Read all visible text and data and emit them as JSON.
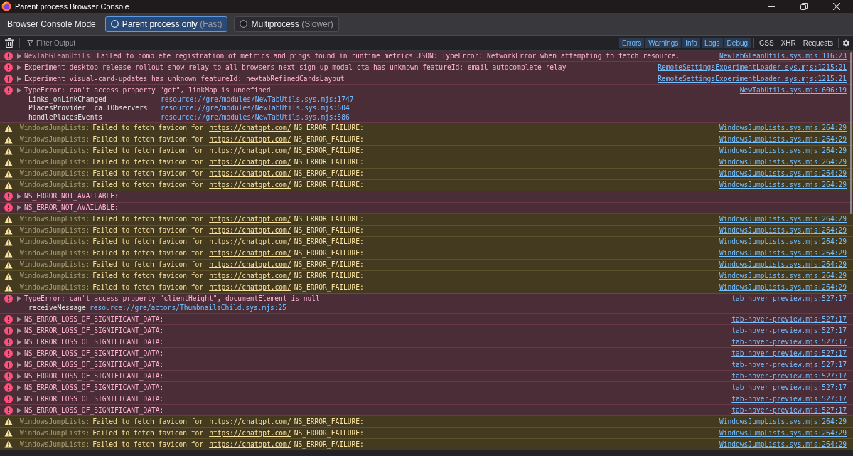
{
  "window": {
    "title": "Parent process Browser Console"
  },
  "mode_bar": {
    "label": "Browser Console Mode",
    "options": [
      {
        "label": "Parent process only",
        "hint": "(Fast)",
        "selected": true
      },
      {
        "label": "Multiprocess",
        "hint": "(Slower)",
        "selected": false
      }
    ]
  },
  "toolbar": {
    "filter_placeholder": "Filter Output",
    "levels": [
      {
        "label": "Errors",
        "selected": true
      },
      {
        "label": "Warnings",
        "selected": true
      },
      {
        "label": "Info",
        "selected": true
      },
      {
        "label": "Logs",
        "selected": true
      },
      {
        "label": "Debug",
        "selected": true
      }
    ],
    "extra_filters": [
      {
        "label": "CSS",
        "selected": false
      },
      {
        "label": "XHR",
        "selected": false
      },
      {
        "label": "Requests",
        "selected": false
      }
    ]
  },
  "messages": [
    {
      "kind": "error",
      "prefix": "NewTabGleanUtils:",
      "text": "Failed to complete registration of metrics and pings found in runtime metrics JSON: TypeError: NetworkError when attempting to fetch resource.",
      "source": "NewTabGleanUtils.sys.mjs:116:23"
    },
    {
      "kind": "error",
      "text": "Experiment desktop-release-rollout-show-relay-to-all-browsers-next-sign-up-modal-cta has unknown featureId: email-autocomplete-relay",
      "source": "RemoteSettingsExperimentLoader.sys.mjs:1215:21"
    },
    {
      "kind": "error",
      "text": "Experiment visual-card-updates has unknown featureId: newtabRefinedCardsLayout",
      "source": "RemoteSettingsExperimentLoader.sys.mjs:1215:21"
    },
    {
      "kind": "error",
      "text": "TypeError: can't access property \"get\", linkMap is undefined",
      "source": "NewTabUtils.sys.mjs:606:19",
      "stack": [
        {
          "function": "Links_onLinkChanged",
          "location": "resource://gre/modules/NewTabUtils.sys.mjs:1747"
        },
        {
          "function": "PlacesProvider__callObservers",
          "location": "resource://gre/modules/NewTabUtils.sys.mjs:604"
        },
        {
          "function": "handlePlacesEvents",
          "location": "resource://gre/modules/NewTabUtils.sys.mjs:586"
        }
      ]
    },
    {
      "kind": "warning",
      "prefix": "WindowsJumpLists:",
      "text": "Failed to fetch favicon for",
      "link": "https://chatgpt.com/",
      "suffix": "NS_ERROR_FAILURE:",
      "source": "WindowsJumpLists.sys.mjs:264:29"
    },
    {
      "kind": "warning",
      "prefix": "WindowsJumpLists:",
      "text": "Failed to fetch favicon for",
      "link": "https://chatgpt.com/",
      "suffix": "NS_ERROR_FAILURE:",
      "source": "WindowsJumpLists.sys.mjs:264:29"
    },
    {
      "kind": "warning",
      "prefix": "WindowsJumpLists:",
      "text": "Failed to fetch favicon for",
      "link": "https://chatgpt.com/",
      "suffix": "NS_ERROR_FAILURE:",
      "source": "WindowsJumpLists.sys.mjs:264:29"
    },
    {
      "kind": "warning",
      "prefix": "WindowsJumpLists:",
      "text": "Failed to fetch favicon for",
      "link": "https://chatgpt.com/",
      "suffix": "NS_ERROR_FAILURE:",
      "source": "WindowsJumpLists.sys.mjs:264:29"
    },
    {
      "kind": "warning",
      "prefix": "WindowsJumpLists:",
      "text": "Failed to fetch favicon for",
      "link": "https://chatgpt.com/",
      "suffix": "NS_ERROR_FAILURE:",
      "source": "WindowsJumpLists.sys.mjs:264:29"
    },
    {
      "kind": "warning",
      "prefix": "WindowsJumpLists:",
      "text": "Failed to fetch favicon for",
      "link": "https://chatgpt.com/",
      "suffix": "NS_ERROR_FAILURE:",
      "source": "WindowsJumpLists.sys.mjs:264:29"
    },
    {
      "kind": "error",
      "text": "NS_ERROR_NOT_AVAILABLE:"
    },
    {
      "kind": "error",
      "text": "NS_ERROR_NOT_AVAILABLE:"
    },
    {
      "kind": "warning",
      "prefix": "WindowsJumpLists:",
      "text": "Failed to fetch favicon for",
      "link": "https://chatgpt.com/",
      "suffix": "NS_ERROR_FAILURE:",
      "source": "WindowsJumpLists.sys.mjs:264:29"
    },
    {
      "kind": "warning",
      "prefix": "WindowsJumpLists:",
      "text": "Failed to fetch favicon for",
      "link": "https://chatgpt.com/",
      "suffix": "NS_ERROR_FAILURE:",
      "source": "WindowsJumpLists.sys.mjs:264:29"
    },
    {
      "kind": "warning",
      "prefix": "WindowsJumpLists:",
      "text": "Failed to fetch favicon for",
      "link": "https://chatgpt.com/",
      "suffix": "NS_ERROR_FAILURE:",
      "source": "WindowsJumpLists.sys.mjs:264:29"
    },
    {
      "kind": "warning",
      "prefix": "WindowsJumpLists:",
      "text": "Failed to fetch favicon for",
      "link": "https://chatgpt.com/",
      "suffix": "NS_ERROR_FAILURE:",
      "source": "WindowsJumpLists.sys.mjs:264:29"
    },
    {
      "kind": "warning",
      "prefix": "WindowsJumpLists:",
      "text": "Failed to fetch favicon for",
      "link": "https://chatgpt.com/",
      "suffix": "NS_ERROR_FAILURE:",
      "source": "WindowsJumpLists.sys.mjs:264:29"
    },
    {
      "kind": "warning",
      "prefix": "WindowsJumpLists:",
      "text": "Failed to fetch favicon for",
      "link": "https://chatgpt.com/",
      "suffix": "NS_ERROR_FAILURE:",
      "source": "WindowsJumpLists.sys.mjs:264:29"
    },
    {
      "kind": "warning",
      "prefix": "WindowsJumpLists:",
      "text": "Failed to fetch favicon for",
      "link": "https://chatgpt.com/",
      "suffix": "NS_ERROR_FAILURE:",
      "source": "WindowsJumpLists.sys.mjs:264:29"
    },
    {
      "kind": "error",
      "text": "TypeError: can't access property \"clientHeight\", documentElement is null",
      "source": "tab-hover-preview.mjs:527:17",
      "stack": [
        {
          "function": "receiveMessage",
          "location": "resource://gre/actors/ThumbnailsChild.sys.mjs:25"
        }
      ]
    },
    {
      "kind": "error",
      "text": "NS_ERROR_LOSS_OF_SIGNIFICANT_DATA:",
      "source": "tab-hover-preview.mjs:527:17"
    },
    {
      "kind": "error",
      "text": "NS_ERROR_LOSS_OF_SIGNIFICANT_DATA:",
      "source": "tab-hover-preview.mjs:527:17"
    },
    {
      "kind": "error",
      "text": "NS_ERROR_LOSS_OF_SIGNIFICANT_DATA:",
      "source": "tab-hover-preview.mjs:527:17"
    },
    {
      "kind": "error",
      "text": "NS_ERROR_LOSS_OF_SIGNIFICANT_DATA:",
      "source": "tab-hover-preview.mjs:527:17"
    },
    {
      "kind": "error",
      "text": "NS_ERROR_LOSS_OF_SIGNIFICANT_DATA:",
      "source": "tab-hover-preview.mjs:527:17"
    },
    {
      "kind": "error",
      "text": "NS_ERROR_LOSS_OF_SIGNIFICANT_DATA:",
      "source": "tab-hover-preview.mjs:527:17"
    },
    {
      "kind": "error",
      "text": "NS_ERROR_LOSS_OF_SIGNIFICANT_DATA:",
      "source": "tab-hover-preview.mjs:527:17"
    },
    {
      "kind": "error",
      "text": "NS_ERROR_LOSS_OF_SIGNIFICANT_DATA:",
      "source": "tab-hover-preview.mjs:527:17"
    },
    {
      "kind": "error",
      "text": "NS_ERROR_LOSS_OF_SIGNIFICANT_DATA:",
      "source": "tab-hover-preview.mjs:527:17"
    },
    {
      "kind": "warning",
      "prefix": "WindowsJumpLists:",
      "text": "Failed to fetch favicon for",
      "link": "https://chatgpt.com/",
      "suffix": "NS_ERROR_FAILURE:",
      "source": "WindowsJumpLists.sys.mjs:264:29"
    },
    {
      "kind": "warning",
      "prefix": "WindowsJumpLists:",
      "text": "Failed to fetch favicon for",
      "link": "https://chatgpt.com/",
      "suffix": "NS_ERROR_FAILURE:",
      "source": "WindowsJumpLists.sys.mjs:264:29"
    },
    {
      "kind": "warning",
      "prefix": "WindowsJumpLists:",
      "text": "Failed to fetch favicon for",
      "link": "https://chatgpt.com/",
      "suffix": "NS_ERROR_FAILURE:",
      "source": "WindowsJumpLists.sys.mjs:264:29"
    }
  ]
}
